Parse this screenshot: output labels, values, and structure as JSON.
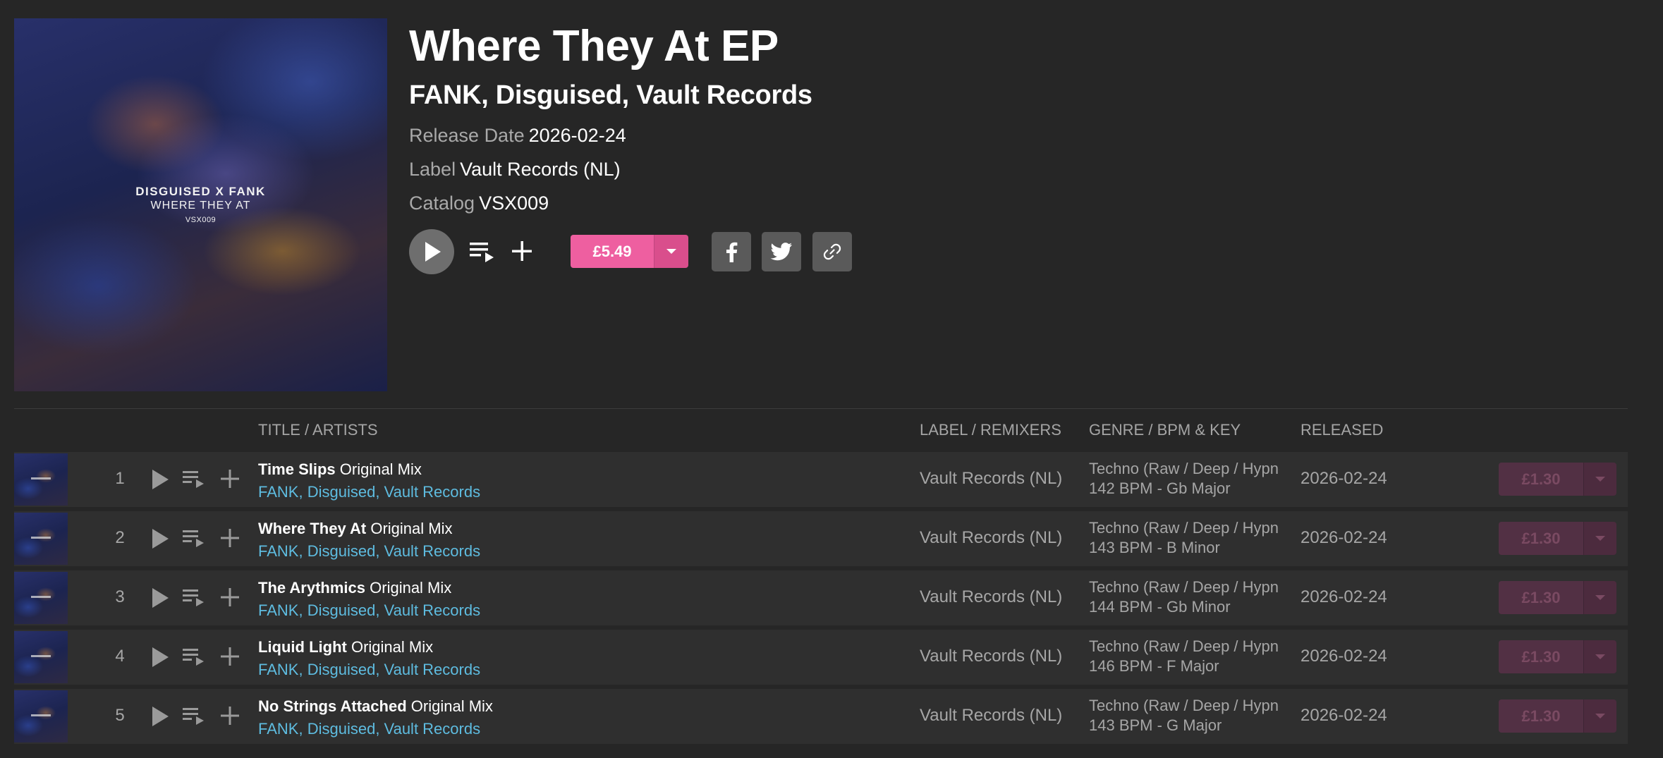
{
  "release": {
    "cover": {
      "line1": "DISGUISED X FANK",
      "line2": "WHERE THEY AT",
      "line3": "VSX009"
    },
    "title": "Where They At EP",
    "artists": [
      "FANK",
      "Disguised",
      "Vault Records"
    ],
    "release_date_label": "Release Date",
    "release_date": "2026-02-24",
    "label_label": "Label",
    "label": "Vault Records (NL)",
    "catalog_label": "Catalog",
    "catalog": "VSX009",
    "price": "£5.49",
    "accent_color": "#ee5fa0"
  },
  "icons": {
    "play": "play-icon",
    "queue": "add-to-queue-icon",
    "add": "plus-icon",
    "dropdown": "chevron-down-icon",
    "facebook": "facebook-icon",
    "twitter": "twitter-icon",
    "link": "link-icon"
  },
  "table": {
    "headers": {
      "title": "TITLE / ARTISTS",
      "label": "LABEL / REMIXERS",
      "genre": "GENRE / BPM & KEY",
      "released": "RELEASED"
    },
    "tracks": [
      {
        "num": "1",
        "title": "Time Slips",
        "mix": "Original Mix",
        "artists": [
          "FANK",
          "Disguised",
          "Vault Records"
        ],
        "label": "Vault Records (NL)",
        "genre": "Techno (Raw / Deep / Hypnotic)",
        "bpm_key": "142 BPM - Gb Major",
        "released": "2026-02-24",
        "price": "£1.30"
      },
      {
        "num": "2",
        "title": "Where They At",
        "mix": "Original Mix",
        "artists": [
          "FANK",
          "Disguised",
          "Vault Records"
        ],
        "label": "Vault Records (NL)",
        "genre": "Techno (Raw / Deep / Hypnotic)",
        "bpm_key": "143 BPM - B Minor",
        "released": "2026-02-24",
        "price": "£1.30"
      },
      {
        "num": "3",
        "title": "The Arythmics",
        "mix": "Original Mix",
        "artists": [
          "FANK",
          "Disguised",
          "Vault Records"
        ],
        "label": "Vault Records (NL)",
        "genre": "Techno (Raw / Deep / Hypnotic)",
        "bpm_key": "144 BPM - Gb Minor",
        "released": "2026-02-24",
        "price": "£1.30"
      },
      {
        "num": "4",
        "title": "Liquid Light",
        "mix": "Original Mix",
        "artists": [
          "FANK",
          "Disguised",
          "Vault Records"
        ],
        "label": "Vault Records (NL)",
        "genre": "Techno (Raw / Deep / Hypnotic)",
        "bpm_key": "146 BPM - F Major",
        "released": "2026-02-24",
        "price": "£1.30"
      },
      {
        "num": "5",
        "title": "No Strings Attached",
        "mix": "Original Mix",
        "artists": [
          "FANK",
          "Disguised",
          "Vault Records"
        ],
        "label": "Vault Records (NL)",
        "genre": "Techno (Raw / Deep / Hypnotic)",
        "bpm_key": "143 BPM - G Major",
        "released": "2026-02-24",
        "price": "£1.30"
      }
    ]
  }
}
